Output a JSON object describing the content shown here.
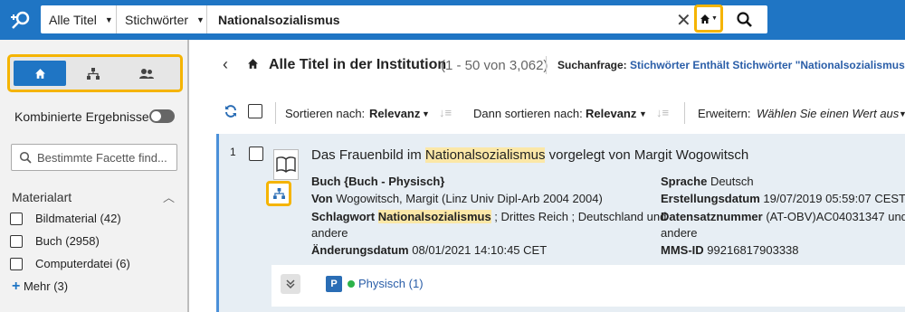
{
  "topbar": {
    "scope_select": "Alle Titel",
    "field_select": "Stichwörter",
    "query": "Nationalsozialismus"
  },
  "sidebar": {
    "combined_results": "Kombinierte Ergebnisse",
    "facet_search_placeholder": "Bestimmte Facette find...",
    "facet_title": "Materialart",
    "facets": [
      {
        "label": "Bildmaterial (42)"
      },
      {
        "label": "Buch (2958)"
      },
      {
        "label": "Computerdatei (6)"
      }
    ],
    "more_label": "Mehr (3)"
  },
  "header": {
    "title": "Alle Titel in der Institution",
    "count": "(1 - 50 von 3,062)",
    "query_label": "Suchanfrage:",
    "query_value": "Stichwörter Enthält Stichwörter \"Nationalsozialismus\""
  },
  "toolbar": {
    "sort_label": "Sortieren nach:",
    "sort_value": "Relevanz",
    "then_sort_label": "Dann sortieren nach:",
    "then_sort_value": "Relevanz",
    "expand_label": "Erweitern:",
    "expand_value": "Wählen Sie einen Wert aus"
  },
  "record": {
    "number": "1",
    "title_pre": "Das Frauenbild im ",
    "title_hl": "Nationalsozialismus",
    "title_post": " vorgelegt von Margit Wogowitsch",
    "type": "Buch {Buch - Physisch}",
    "author_label": "Von",
    "author_value": "Wogowitsch, Margit (Linz Univ Dipl-Arb 2004 2004)",
    "subject_label": "Schlagwort",
    "subject_hl": "Nationalsozialismus",
    "subject_rest": " ; Drittes Reich ; Deutschland und",
    "subject_cont": "andere",
    "modified_label": "Änderungsdatum",
    "modified_value": "08/01/2021 14:10:45 CET",
    "language_label": "Sprache",
    "language_value": "Deutsch",
    "created_label": "Erstellungsdatum",
    "created_value": "19/07/2019 05:59:07 CEST",
    "recordnr_label": "Datensatznummer",
    "recordnr_value": "(AT-OBV)AC04031347 und",
    "recordnr_cont": "andere",
    "mmsid_label": "MMS-ID",
    "mmsid_value": "99216817903338",
    "holdings_badge": "P",
    "holdings_label": "Physisch (1)"
  },
  "colors": {
    "brand_blue": "#1f75c4",
    "highlight_outline": "#f5b400",
    "availability_green": "#2db34a"
  },
  "icons": [
    "app-logo-icon",
    "clear-icon",
    "home-icon",
    "search-icon",
    "hierarchy-icon",
    "users-icon",
    "back-chevron-icon",
    "refresh-icon",
    "book-icon",
    "expand-chevron-icon"
  ]
}
